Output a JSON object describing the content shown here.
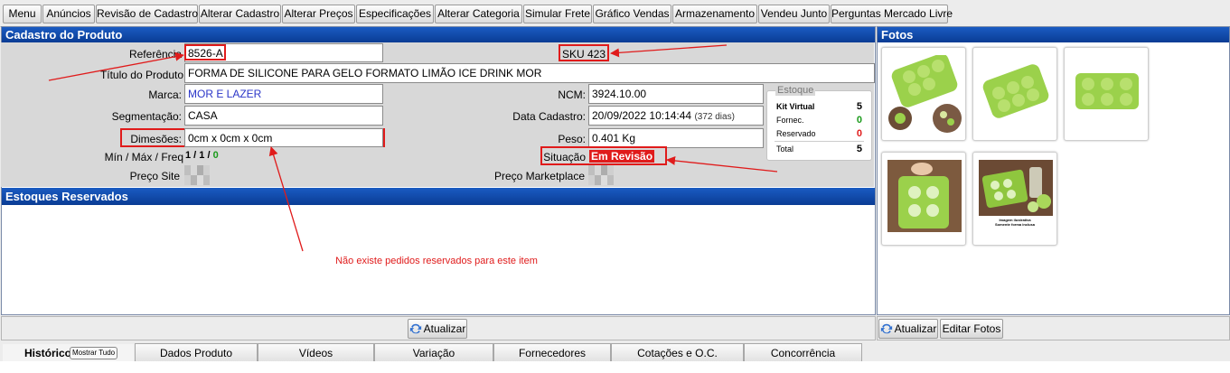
{
  "menu": [
    "Menu",
    "Anúncios",
    "Revisão de Cadastro",
    "Alterar Cadastro",
    "Alterar Preços",
    "Especificações",
    "Alterar Categoria",
    "Simular Frete",
    "Gráfico Vendas",
    "Armazenamento",
    "Vendeu Junto",
    "Perguntas Mercado Livre"
  ],
  "cadastro": {
    "title": "Cadastro do Produto",
    "referencia_label": "Referência",
    "referencia_value": "8526-A",
    "sku": "SKU 423",
    "titulo_label": "Título do Produto",
    "titulo_value": "FORMA DE SILICONE PARA GELO FORMATO LIMÃO ICE DRINK MOR",
    "marca_label": "Marca:",
    "marca_value": "MOR E LAZER",
    "ncm_label": "NCM:",
    "ncm_value": "3924.10.00",
    "segmentacao_label": "Segmentação:",
    "segmentacao_value": "CASA",
    "data_cadastro_label": "Data Cadastro:",
    "data_cadastro_value": "20/09/2022 10:14:44",
    "data_cadastro_days": "(372 dias)",
    "dimesoes_label": "Dimesões:",
    "dimesoes_value": "0cm x 0cm x 0cm",
    "peso_label": "Peso:",
    "peso_value": "0.401 Kg",
    "minmax_label": "Mín / Máx / Freq",
    "minmax_min": "1",
    "minmax_sep1": " / ",
    "minmax_max": "1",
    "minmax_sep2": " / ",
    "minmax_freq": "0",
    "situacao_label": "Situação",
    "situacao_value": "Em Revisão",
    "preco_site_label": "Preço Site",
    "preco_marketplace_label": "Preço Marketplace"
  },
  "estoque": {
    "legend": "Estoque",
    "kit_virtual_label": "Kit Virtual",
    "kit_virtual_value": "5",
    "fornec_label": "Fornec.",
    "fornec_value": "0",
    "reservado_label": "Reservado",
    "reservado_value": "0",
    "total_label": "Total",
    "total_value": "5"
  },
  "reservados": {
    "title": "Estoques Reservados",
    "message": "Não existe pedidos reservados para este item",
    "atualizar": "Atualizar"
  },
  "fotos": {
    "title": "Fotos",
    "atualizar": "Atualizar",
    "editar": "Editar Fotos",
    "thumb_caption_1": "Imagem ilustrativa",
    "thumb_caption_2": "Somente forma inclusa"
  },
  "tabs": {
    "historico": "Histórico",
    "mostrar_tudo": "Mostrar Tudo",
    "items": [
      "Dados Produto",
      "Vídeos",
      "Variação",
      "Fornecedores",
      "Cotações e O.C.",
      "Concorrência"
    ]
  },
  "colors": {
    "header_blue": "#0a3c94",
    "annotation_red": "#e01b1b",
    "lime_green": "#9bd14b",
    "situacao_bg": "#e01b1b"
  }
}
